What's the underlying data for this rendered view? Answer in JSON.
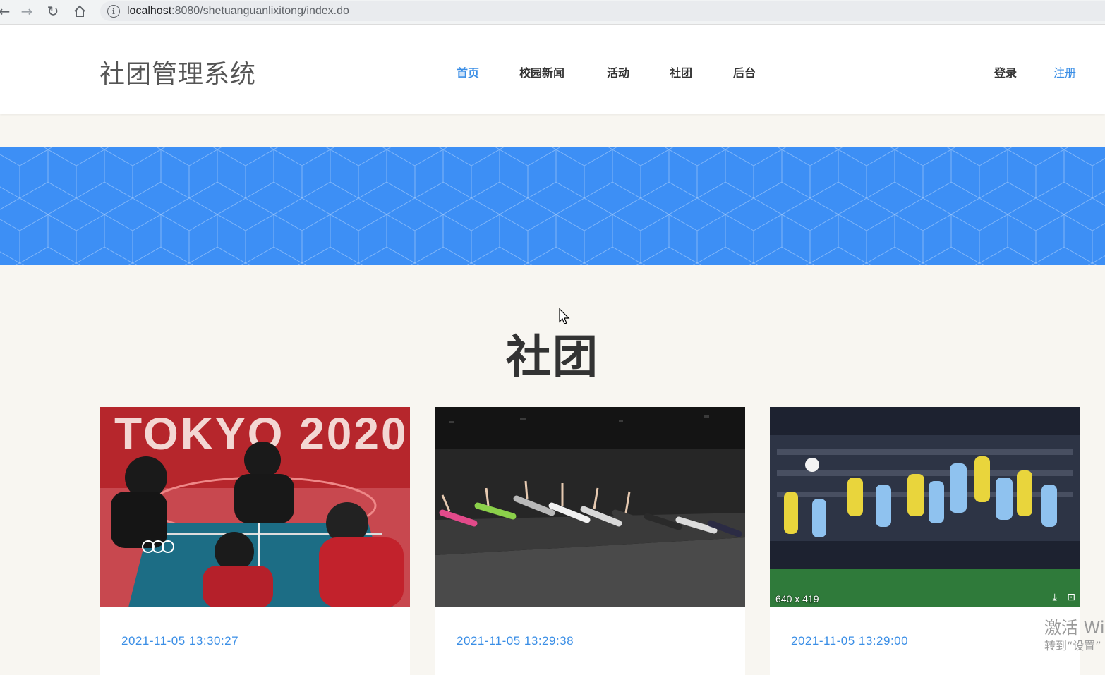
{
  "browser": {
    "url_host": "localhost",
    "url_rest": ":8080/shetuanguanlixitong/index.do"
  },
  "header": {
    "site_title": "社团管理系统",
    "nav": [
      {
        "label": "首页",
        "active": true
      },
      {
        "label": "校园新闻",
        "active": false
      },
      {
        "label": "活动",
        "active": false
      },
      {
        "label": "社团",
        "active": false
      },
      {
        "label": "后台",
        "active": false
      }
    ],
    "login_label": "登录",
    "register_label": "注册"
  },
  "section": {
    "title": "社团"
  },
  "cards": [
    {
      "date": "2021-11-05 13:30:27",
      "image_text": "TOKYO 2020"
    },
    {
      "date": "2021-11-05 13:29:38"
    },
    {
      "date": "2021-11-05 13:29:00",
      "image_size_label": "640 x 419"
    }
  ],
  "watermark": {
    "line1": "激活 Wi",
    "line2": "转到“设置”"
  },
  "colors": {
    "accent": "#3a8ee6",
    "banner": "#3d8ff5",
    "page_bg": "#f8f6f1"
  }
}
